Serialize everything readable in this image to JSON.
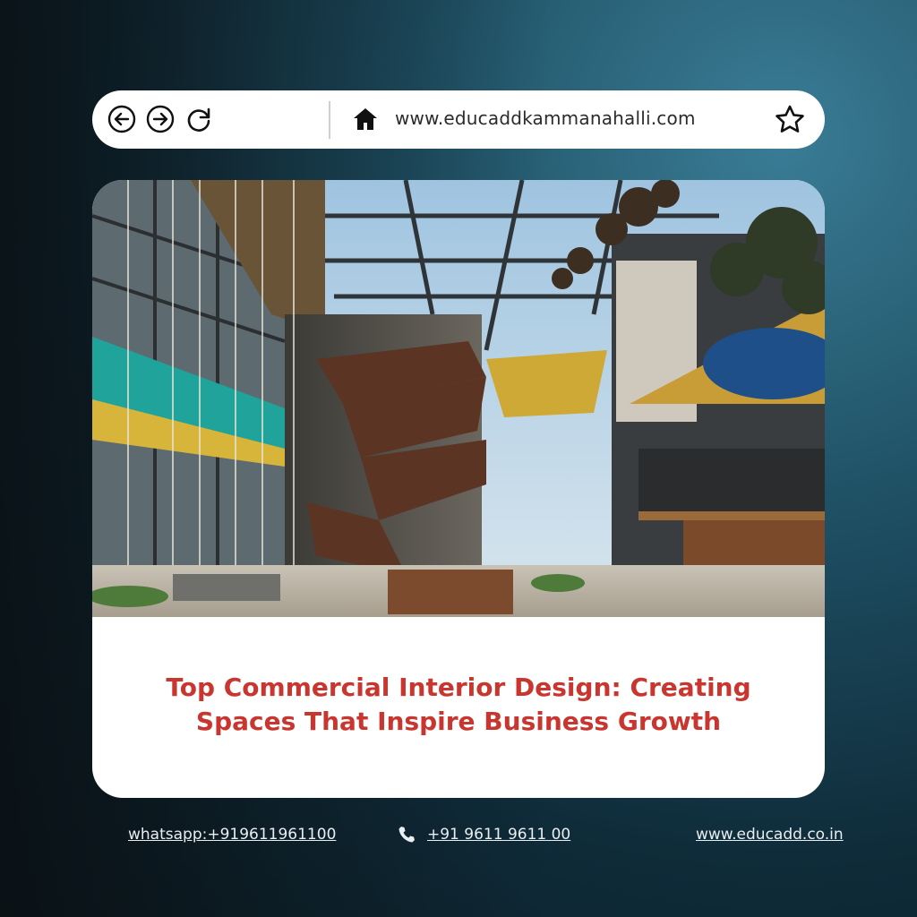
{
  "browser": {
    "url": "www.educaddkammanahalli.com",
    "icons": [
      "back-arrow-icon",
      "forward-arrow-icon",
      "reload-icon",
      "home-icon",
      "star-icon"
    ]
  },
  "card": {
    "headline_line1": "Top Commercial Interior Design: Creating",
    "headline_line2": "Spaces That Inspire Business Growth",
    "image_alt": "commercial interior atrium with glass roof and staircase"
  },
  "footer": {
    "whatsapp": "whatsapp:+919611961100",
    "phone": "+91 9611 9611 00",
    "website": "www.educadd.co.in"
  },
  "colors": {
    "headline": "#c9362f",
    "background": "#1e4f63",
    "card": "#ffffff"
  }
}
